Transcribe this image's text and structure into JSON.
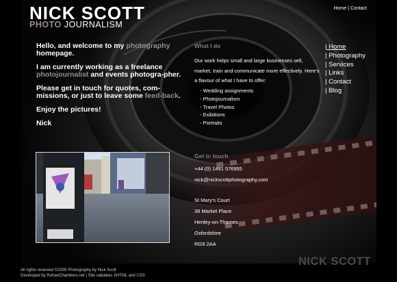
{
  "header": {
    "logo_title": "NICK SCOTT",
    "logo_photo": "PHOTO",
    "logo_journalism": "JOURNALISM",
    "top_links": {
      "home": "Home",
      "separator": " | ",
      "contact": "Contact"
    }
  },
  "intro": {
    "welcome_before": "Hello, and welcome to my ",
    "welcome_link": "photography",
    "welcome_after": " homepage.",
    "working_before": "I am currently working as a freelance ",
    "working_link": "photojournalist",
    "working_after": " and events photogra-pher.",
    "contact_before": "Please get in touch for quotes, com-missions, or just to leave some ",
    "contact_link": "feed-back",
    "contact_after": ".",
    "enjoy": "Enjoy the pictures!",
    "signature": "Nick"
  },
  "what_i_do": {
    "heading": "What I do",
    "para": "Our work helps small and large businesses sell, market, train and communicate more effectively. Here's a flavour of what I have to offer:",
    "services": [
      "- Wedding assignments",
      "- Photojournalism",
      "- Travel Photos",
      "- Exibitions",
      "- Portraits"
    ]
  },
  "get_in_touch": {
    "heading": "Get in touch",
    "phone": "+44 (0) 1491 576955",
    "email": "nick@nickscottphotography.com",
    "address": [
      "St Mary's Court",
      "39 Market Place",
      "Henley-on-Thames",
      "Oxfordshire",
      "RG9 2AA"
    ]
  },
  "nav": {
    "items": [
      "| Home",
      "| Photography",
      "| Services",
      "| Links",
      "| Contact",
      "| Blog"
    ]
  },
  "footer": {
    "name": "NICK SCOTT",
    "line1": "All rights reserved ©2009 Photography by Nick Scott",
    "line2": "Developed by RohanChambers.net | Site validates XHTML and CSS"
  },
  "colors": {
    "accent": "#9c8a99",
    "heading": "#8a7a88",
    "background": "#050505"
  }
}
